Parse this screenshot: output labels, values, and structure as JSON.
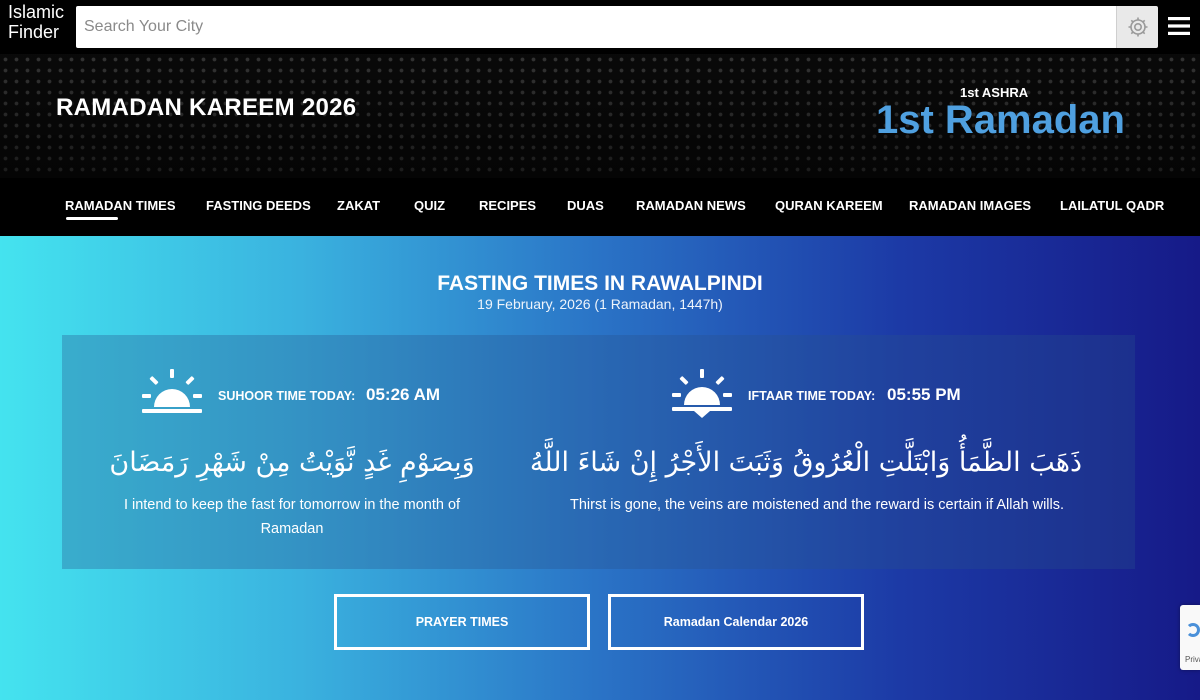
{
  "header": {
    "logo_line1": "Islamic",
    "logo_line2": "Finder",
    "search_placeholder": "Search Your City",
    "settings_icon": "gear-icon",
    "menu_icon": "hamburger-menu-icon"
  },
  "hero": {
    "title": "RAMADAN KAREEM 2026",
    "ashra": "1st ASHRA",
    "day": "1st Ramadan",
    "accent_color": "#4fa0e0"
  },
  "nav": {
    "items": [
      {
        "label": "RAMADAN TIMES",
        "active": true
      },
      {
        "label": "FASTING DEEDS"
      },
      {
        "label": "ZAKAT"
      },
      {
        "label": "QUIZ"
      },
      {
        "label": "RECIPES"
      },
      {
        "label": "DUAS"
      },
      {
        "label": "RAMADAN NEWS"
      },
      {
        "label": "QURAN KAREEM"
      },
      {
        "label": "RAMADAN IMAGES"
      },
      {
        "label": "LAILATUL QADR"
      }
    ]
  },
  "fasting": {
    "title": "FASTING TIMES IN RAWALPINDI",
    "date": "19 February, 2026 (1 Ramadan, 1447h)",
    "suhoor": {
      "label": "SUHOOR TIME TODAY:",
      "time": "05:26 AM",
      "icon": "sunrise-icon",
      "dua_arabic": "وَبِصَوْمِ غَدٍ نَّوَيْتُ مِنْ شَهْرِ رَمَضَانَ",
      "dua_translation": "I intend to keep the fast for tomorrow in the month of Ramadan"
    },
    "iftaar": {
      "label": "IFTAAR TIME TODAY:",
      "time": "05:55 PM",
      "icon": "sunset-icon",
      "dua_arabic": "ذَهَبَ الظَّمَأُ وَابْتَلَّتِ الْعُرُوقُ وَثَبَتَ الأَجْرُ إِنْ شَاءَ اللَّهُ",
      "dua_translation": "Thirst is gone, the veins are moistened and the reward is certain if Allah wills."
    }
  },
  "buttons": {
    "prayer_times": "PRAYER TIMES",
    "calendar": "Ramadan Calendar 2026"
  },
  "recaptcha": {
    "text": "Privacy"
  }
}
